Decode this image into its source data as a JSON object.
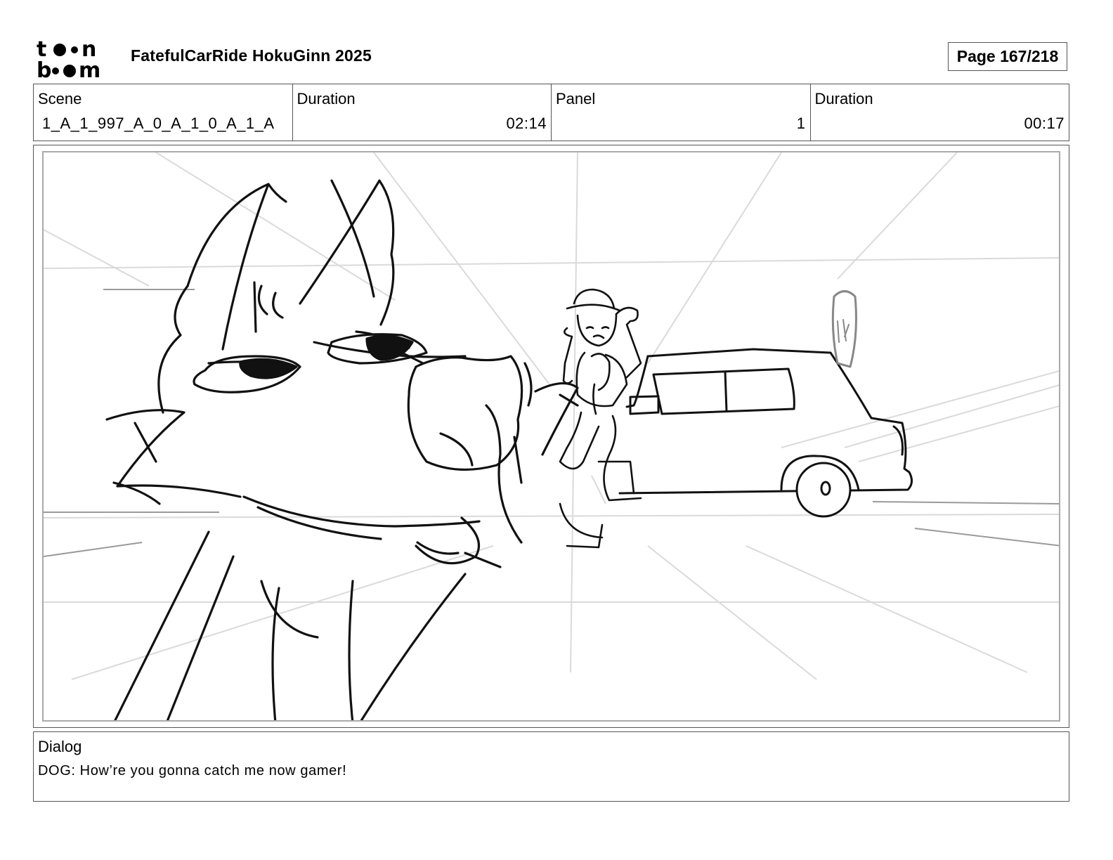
{
  "header": {
    "logo_text": "toonboom",
    "project_title": "FatefulCarRide HokuGinn 2025",
    "page_label": "Page 167/218"
  },
  "info": {
    "scene_label": "Scene",
    "scene_value": "1_A_1_997_A_0_A_1_0_A_1_A",
    "scene_duration_label": "Duration",
    "scene_duration_value": "02:14",
    "panel_label": "Panel",
    "panel_value": "1",
    "panel_duration_label": "Duration",
    "panel_duration_value": "00:17"
  },
  "dialog": {
    "label": "Dialog",
    "text": "DOG: How’re you gonna catch me now gamer!"
  }
}
